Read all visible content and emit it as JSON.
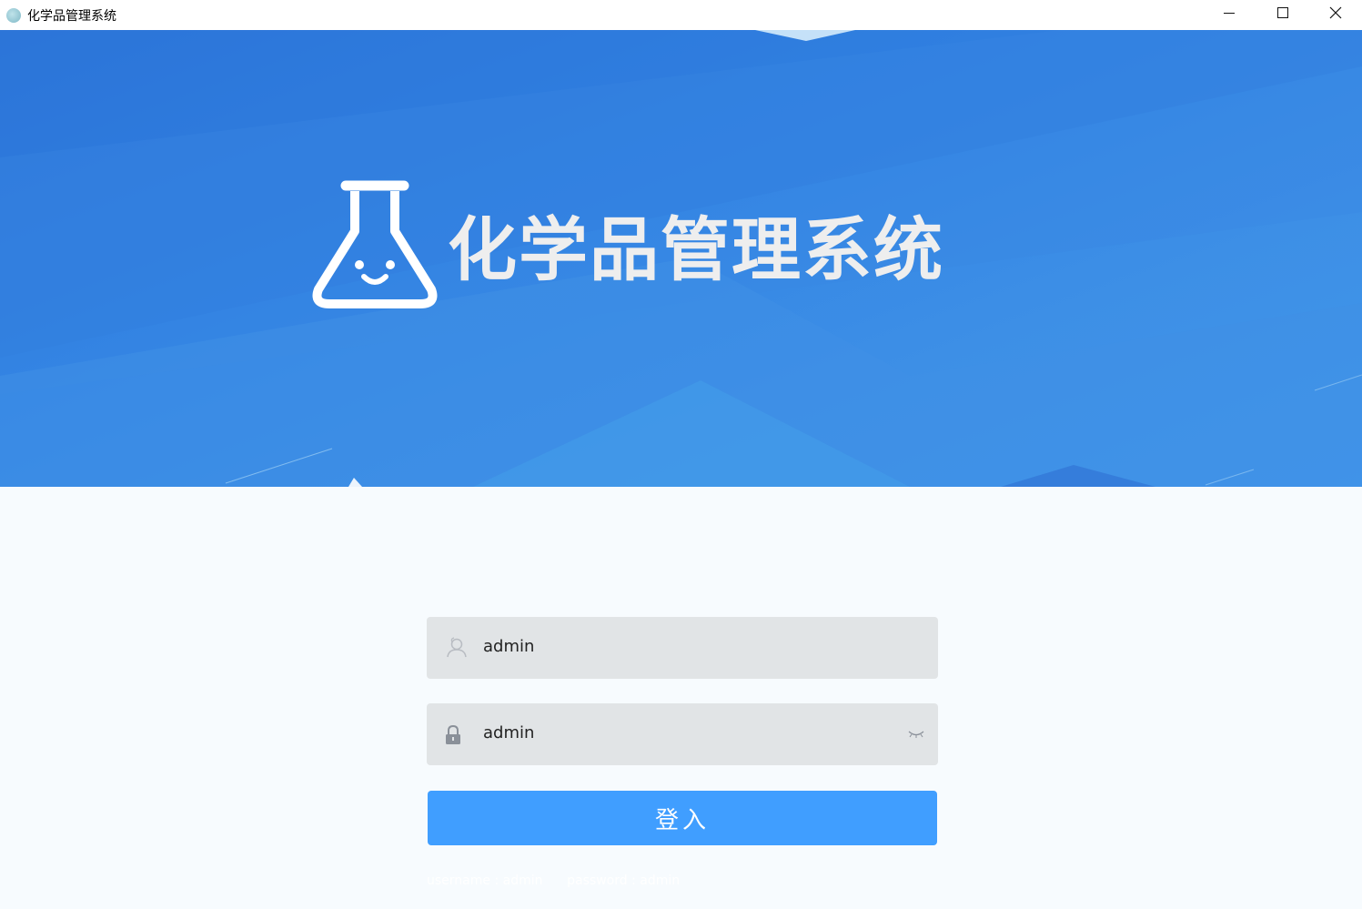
{
  "window": {
    "title": "化学品管理系统",
    "icon": "app-icon"
  },
  "banner": {
    "title": "化学品管理系统",
    "logo_icon": "flask-icon"
  },
  "form": {
    "username": {
      "value": "admin",
      "icon": "user-icon"
    },
    "password": {
      "value": "admin",
      "icon": "lock-icon",
      "toggle_icon": "eye-closed-icon"
    },
    "login_button_label": "登入",
    "hint": "username : admin      password : admin"
  },
  "colors": {
    "banner_blue": "#3284e4",
    "button_blue": "#409eff",
    "field_bg": "#e1e4e6",
    "page_bg": "#f7fbfe"
  }
}
